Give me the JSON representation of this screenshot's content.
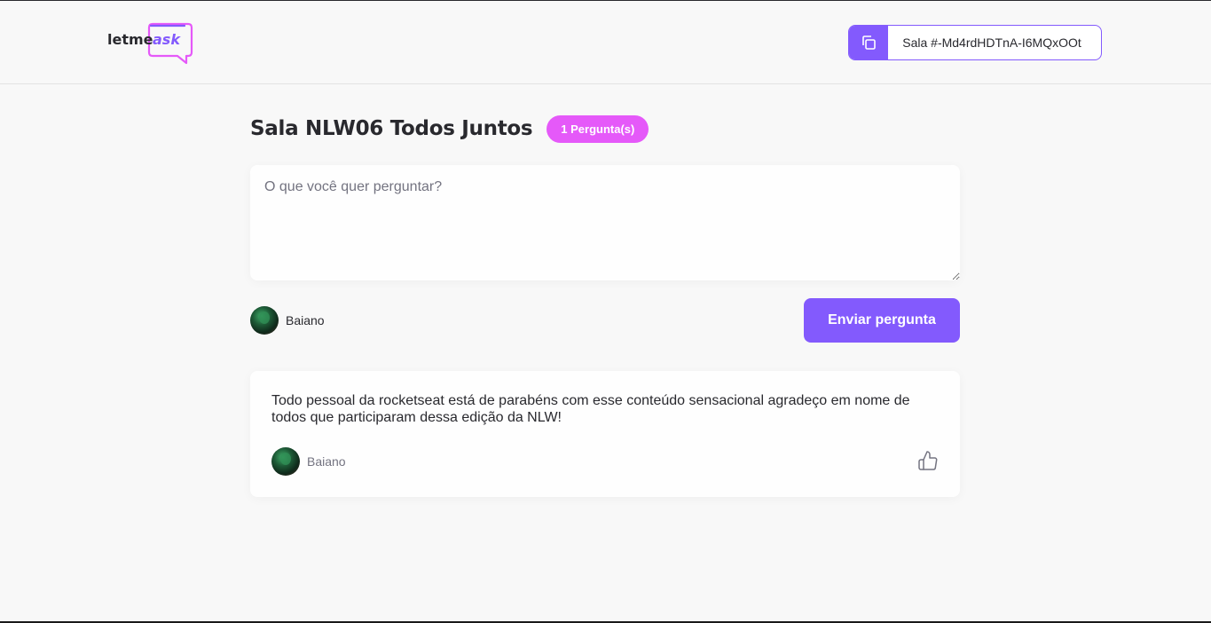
{
  "header": {
    "logo": {
      "text_primary": "letme",
      "text_accent": "ask"
    },
    "room_code": {
      "icon": "copy-icon",
      "label": "Sala #-Md4rdHDTnA-I6MQxOOt"
    }
  },
  "room": {
    "title": "Sala NLW06 Todos Juntos",
    "question_count": "1 Pergunta(s)"
  },
  "form": {
    "placeholder": "O que você quer perguntar?",
    "value": "",
    "user_name": "Baiano",
    "submit_label": "Enviar pergunta"
  },
  "questions": [
    {
      "content": "Todo pessoal da rocketseat está de parabéns com esse conteúdo sensacional agradeço em nome de todos que participaram dessa edição da NLW!",
      "author": "Baiano",
      "like_icon": "thumbs-up-icon"
    }
  ],
  "colors": {
    "primary": "#835afd",
    "badge": "#e559f9",
    "text": "#29292e",
    "muted": "#737380",
    "background": "#f8f8f8"
  }
}
